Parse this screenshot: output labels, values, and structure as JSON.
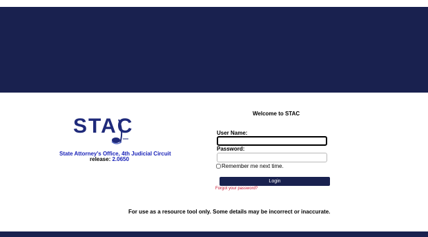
{
  "header": {
    "band_color": "#19214f"
  },
  "logo": {
    "text": "STAC",
    "office": "State Attorney's Office, 4th Judicial Circuit",
    "release_label": "release:",
    "release_version": "2.0650",
    "colors": {
      "text": "#1f2a7a",
      "accent": "#1a23b8"
    }
  },
  "login": {
    "welcome": "Welcome to STAC",
    "username_label": "User Name:",
    "username_value": "",
    "password_label": "Password:",
    "password_value": "",
    "remember_label": "Remember me next time.",
    "remember_checked": false,
    "login_button": "Login",
    "forgot_link": "Forgot your password?"
  },
  "footer": {
    "disclaimer": "For use as a resource tool only. Some details may be incorrect or inaccurate."
  }
}
